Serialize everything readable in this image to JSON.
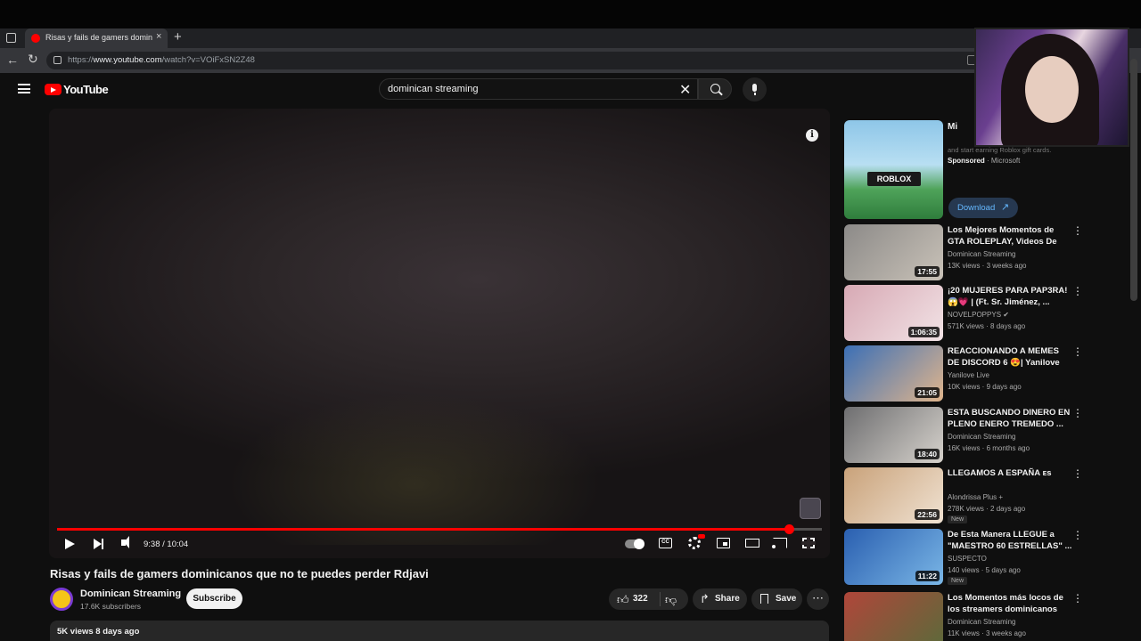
{
  "browser": {
    "tab_title": "Risas y fails de gamers dominicanos que no te puedes perder Rdjavi - YouTube",
    "url_prefix": "https://",
    "url_host": "www.youtube.com",
    "url_path": "/watch?v=VOiFxSN2Z48"
  },
  "youtube": {
    "logo_text": "YouTube",
    "search_query": "dominican streaming"
  },
  "player": {
    "info_glyph": "i",
    "time": "9:38 / 10:04",
    "progress": 0.957,
    "cc_label": "CC"
  },
  "video": {
    "title": "Risas y fails de gamers dominicanos que no te puedes perder Rdjavi",
    "channel": "Dominican Streaming",
    "subscribers": "17.6K subscribers",
    "subscribe_label": "Subscribe",
    "likes": "322",
    "share_label": "Share",
    "save_label": "Save",
    "more_glyph": "⋯",
    "meta": "5K views  8 days ago"
  },
  "ad": {
    "title": "Mi",
    "thumb_logo": "RОBLOX",
    "description": "and start earning Roblox gift cards.",
    "sponsored_label": "Sponsored",
    "advertiser": "· Microsoft",
    "download_label": "Download"
  },
  "recommendations": [
    {
      "title": "Los Mejores Momentos de GTA ROLEPLAY, Videos De Risa",
      "channel": "Dominican Streaming",
      "stats": "13K views · 3 weeks ago",
      "duration": "17:55",
      "badge": "",
      "colors": [
        "#8c8a88",
        "#c9c2b8"
      ]
    },
    {
      "title": "¡20 MUJERES PARA PAP3RA! 😱💗 | (Ft. Sr. Jiménez, ...",
      "channel": "NOVELPOPPYS ✔",
      "stats": "571K views · 8 days ago",
      "duration": "1:06:35",
      "badge": "",
      "colors": [
        "#d7a9b4",
        "#f2e3e6"
      ]
    },
    {
      "title": "REACCIONANDO A MEMES DE DISCORD 6 😍| Yanilove",
      "channel": "Yanilove Live",
      "stats": "10K views · 9 days ago",
      "duration": "21:05",
      "badge": "",
      "colors": [
        "#3b6fb6",
        "#e0b58c"
      ]
    },
    {
      "title": "ESTA BUSCANDO DINERO EN PLENO ENERO TREMEDO ...",
      "channel": "Dominican Streaming",
      "stats": "16K views · 6 months ago",
      "duration": "18:40",
      "badge": "",
      "colors": [
        "#6e6e70",
        "#d6d2cc"
      ]
    },
    {
      "title": "LLEGAMOS A ESPAÑA ᴇs",
      "channel": "Alondrissa Plus +",
      "stats": "278K views · 2 days ago",
      "duration": "22:56",
      "badge": "New",
      "colors": [
        "#c9a27a",
        "#f0e2d2"
      ]
    },
    {
      "title": "De Esta Manera LLEGUE a \"MAESTRO 60 ESTRELLAS\" ...",
      "channel": "SUSPECTO",
      "stats": "140 views · 5 days ago",
      "duration": "11:22",
      "badge": "New",
      "colors": [
        "#2a5fb0",
        "#7ab6e6"
      ]
    },
    {
      "title": "Los Momentos más locos de los streamers dominicanos en...",
      "channel": "Dominican Streaming",
      "stats": "11K views · 3 weeks ago",
      "duration": "",
      "badge": "",
      "colors": [
        "#b0463a",
        "#5c6a3a"
      ]
    }
  ],
  "colors": {
    "accent_red": "#ff0000",
    "background": "#0f0f0f",
    "link_blue": "#65b8ff"
  }
}
